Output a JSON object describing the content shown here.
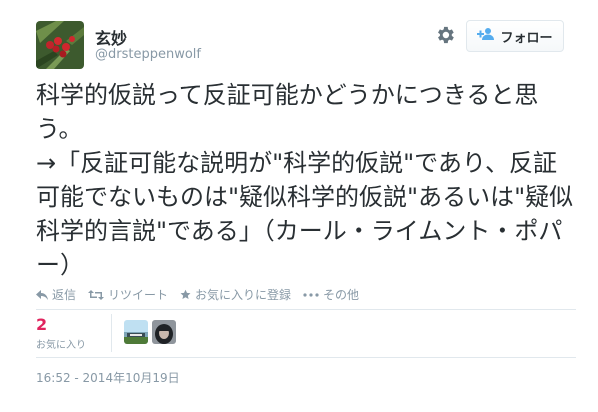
{
  "user": {
    "name": "玄妙",
    "handle": "@drsteppenwolf"
  },
  "follow_button": {
    "label": "フォロー"
  },
  "tweet": {
    "text": "科学的仮説って反証可能かどうかにつきると思う。\n→「反証可能な説明が\"科学的仮説\"であり、反証可能でないものは\"疑似科学的仮説\"あるいは\"疑似科学的言説\"である」（カール・ライムント・ポパー）"
  },
  "actions": {
    "reply": "返信",
    "retweet": "リツイート",
    "favorite": "お気に入りに登録",
    "more": "その他"
  },
  "stats": {
    "favorites_count": "2",
    "favorites_label": "お気に入り"
  },
  "timestamp": "16:52 - 2014年10月19日",
  "colors": {
    "text": "#292f33",
    "muted": "#8899a6",
    "favorite_count": "#e0245e",
    "follow_icon": "#55acee"
  },
  "icons": [
    "gear-icon",
    "follow-user-icon",
    "reply-icon",
    "retweet-icon",
    "star-icon",
    "more-icon"
  ]
}
